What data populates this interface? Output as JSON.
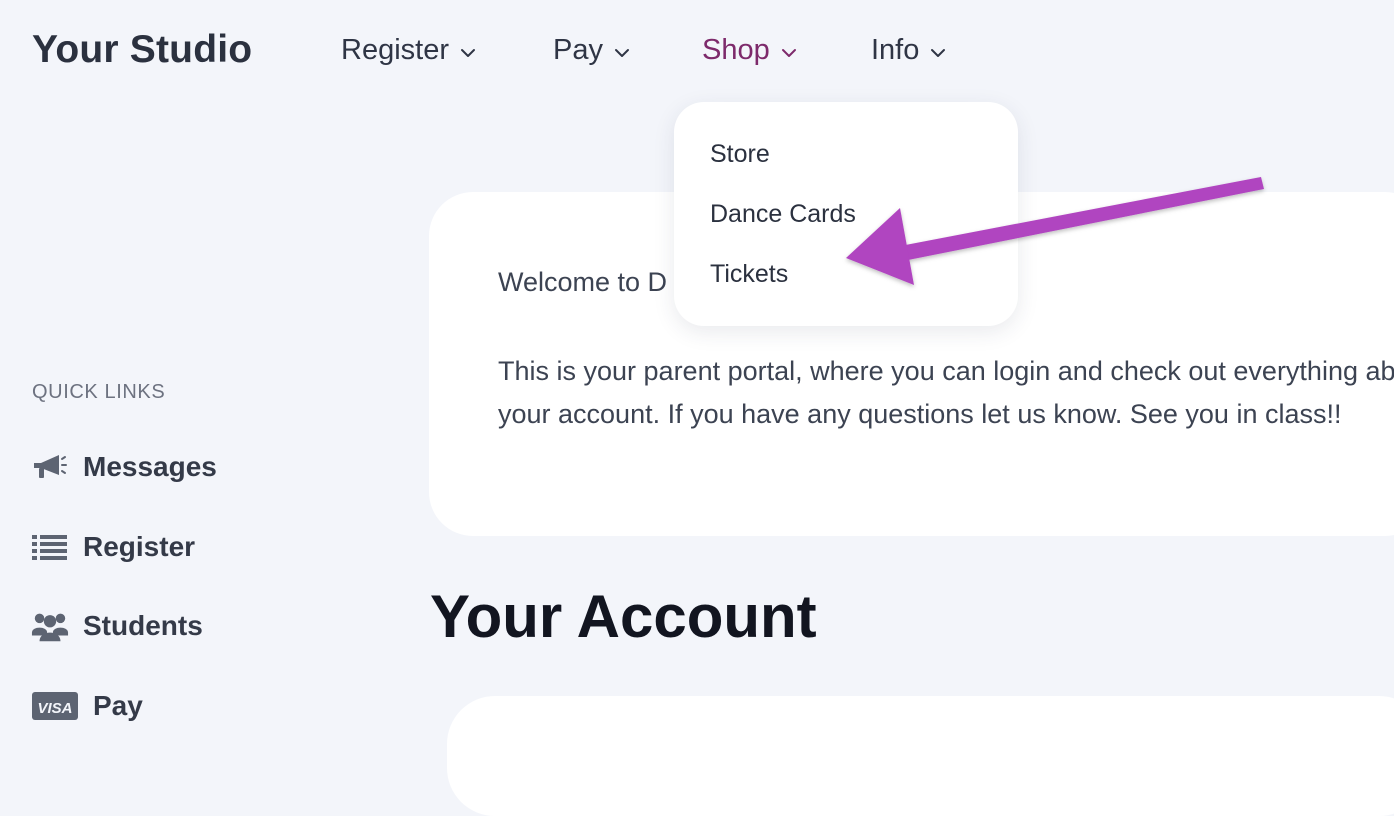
{
  "brand": "Your Studio",
  "nav": [
    {
      "label": "Register"
    },
    {
      "label": "Pay"
    },
    {
      "label": "Shop"
    },
    {
      "label": "Info"
    }
  ],
  "dropdown": {
    "items": [
      {
        "label": "Store"
      },
      {
        "label": "Dance Cards"
      },
      {
        "label": "Tickets"
      }
    ]
  },
  "sidebar": {
    "heading": "QUICK LINKS",
    "items": [
      {
        "label": "Messages",
        "icon": "megaphone-icon"
      },
      {
        "label": "Register",
        "icon": "list-icon"
      },
      {
        "label": "Students",
        "icon": "users-icon"
      },
      {
        "label": "Pay",
        "icon": "visa-card-icon"
      }
    ]
  },
  "main": {
    "welcome_title": "Welcome to D",
    "welcome_body": "This is your parent portal, where you can login and check out everything about your account. If you have any questions let us know. See you in class!!",
    "account_heading": "Your Account"
  },
  "colors": {
    "active_nav": "#7d2a6b",
    "annotation_arrow": "#b044c0",
    "background": "#f3f5fa"
  }
}
